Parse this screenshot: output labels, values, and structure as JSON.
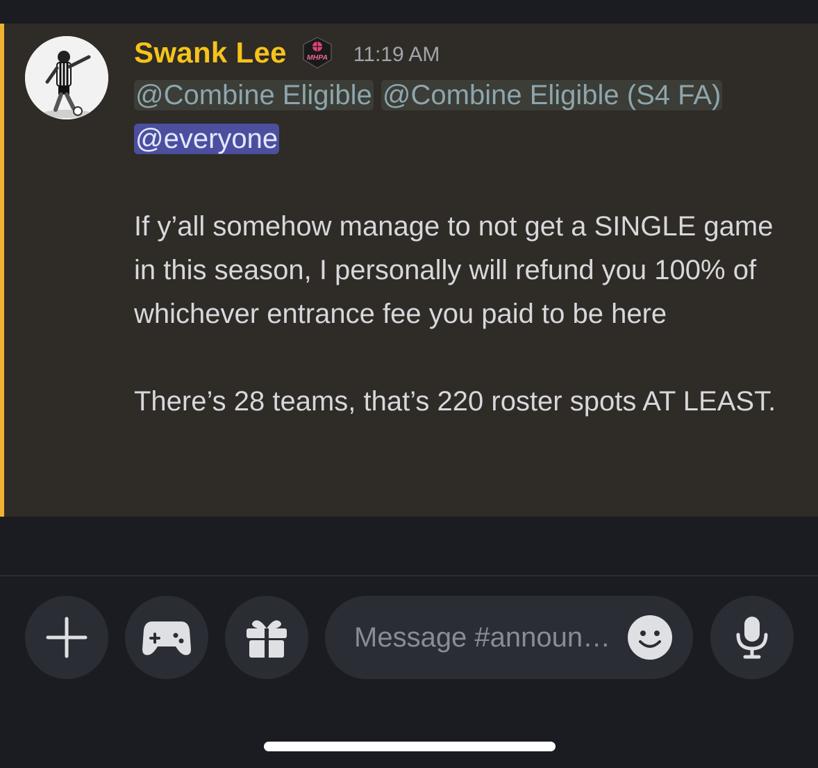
{
  "message": {
    "author": "Swank Lee",
    "role_badge_text": "MHPA",
    "timestamp": "11:19 AM",
    "mentions": [
      "@Combine Eligible",
      "@Combine Eligible (S4 FA)",
      "@everyone"
    ],
    "paragraphs": [
      "If y’all somehow manage to not get a SINGLE game in this season, I personally will refund you 100% of whichever entrance fee you paid to be here",
      "There’s 28 teams, that’s 220 roster spots AT LEAST."
    ]
  },
  "composer": {
    "placeholder": "Message #announ…",
    "buttons": [
      "plus",
      "activities",
      "gift",
      "emoji",
      "microphone"
    ]
  },
  "colors": {
    "author": "#f5c31b",
    "accent_bar": "#f0b232",
    "mention_everyone_bg": "#4b4f9e",
    "message_bg": "#2f2b26",
    "app_bg": "#1b1c21"
  }
}
